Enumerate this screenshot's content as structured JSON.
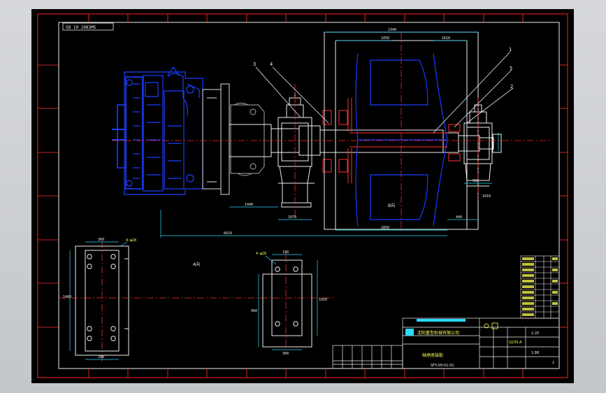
{
  "drawing": {
    "code_box": "SD 10 1083M5",
    "code_number": "SFY-XH-01-01",
    "view_label": "A向",
    "view_label2": "B向",
    "dims": {
      "top_overall": "2340",
      "top_left": "1050",
      "top_right": "1610",
      "bottom_overall": "6610",
      "bottom_right": "2850",
      "motor_base": "1440",
      "bearing_base": "1070",
      "shaft_end": "440",
      "foot_span": "900",
      "right_base": "1010"
    },
    "callouts": [
      "1",
      "2",
      "3",
      "4",
      "5"
    ],
    "plan_left": {
      "tag": "4-φ28",
      "dim_top": "360",
      "dim_side": "1460",
      "dim_bottom": "390"
    },
    "plan_right": {
      "tag": "4-φ28",
      "dim_top": "190",
      "dim_side": "960",
      "dim_right": "1050",
      "dim_bottom": "300"
    }
  },
  "title_block": {
    "company": "沈阳重型机械有限公司",
    "drawing_name": "轴承座装配",
    "drawing_no": "SFY-XH-01-01",
    "scale": "1:20",
    "material": "Q235-A",
    "sheet": "1",
    "weight": "1.88"
  },
  "colors": {
    "background": "#000000",
    "frame": "#ffffff",
    "motor": "#1a3cff",
    "outline": "#ffffff",
    "centerline": "#ff2a2a",
    "dimension": "#2bd9ff",
    "title_text": "#ffff55",
    "accent_red": "#ff3030"
  }
}
